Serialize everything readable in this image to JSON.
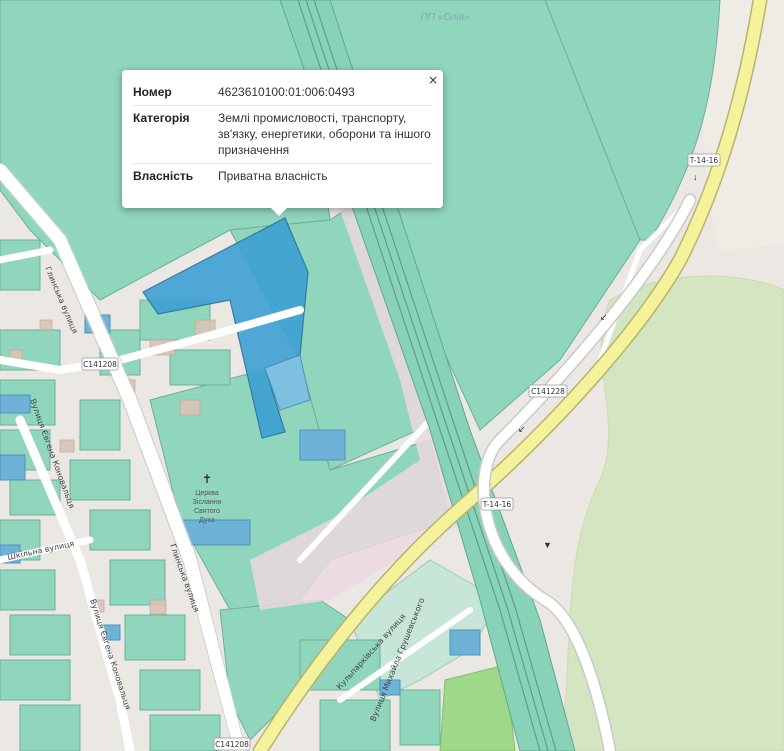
{
  "popup": {
    "close_symbol": "×",
    "rows": [
      {
        "key": "Номер",
        "value": "4623610100:01:006:0493"
      },
      {
        "key": "Категорія",
        "value": "Землі промисловості, транспорту, зв'язку, енергетики, оборони та іншого призначення"
      },
      {
        "key": "Власність",
        "value": "Приватна власність"
      }
    ]
  },
  "map_labels": {
    "poi_oliar": "ПП «Олія»",
    "church_line1": "Церква",
    "church_line2": "Зіслання",
    "church_line3": "Святого",
    "church_line4": "Духа",
    "street_hlynska_top": "Глинська вулиця",
    "street_hlynska_bottom": "Глинська вулиця",
    "street_konovalets_top": "Вулиця Євгена Коновальця",
    "street_konovalets_bottom": "Вулиця Євгена Коновальця",
    "street_small": "Шкільна вулиця",
    "street_kulparkivska": "Кульпарківська вулиця",
    "street_hrushevskoho": "Вулиця Михайла Грушевського"
  },
  "road_shields": {
    "c141208_a": "C141208",
    "c141208_b": "C141208",
    "c141228": "C141228",
    "t1416_a": "T-14-16",
    "t1416_b": "T-14-16"
  },
  "colors": {
    "parcel_teal": "#8fd6bd",
    "parcel_selected": "#3ea0d4",
    "parcel_blue": "#6eb2d8",
    "field_green": "#d6e8c4",
    "road_yellow": "#f4f29a"
  }
}
